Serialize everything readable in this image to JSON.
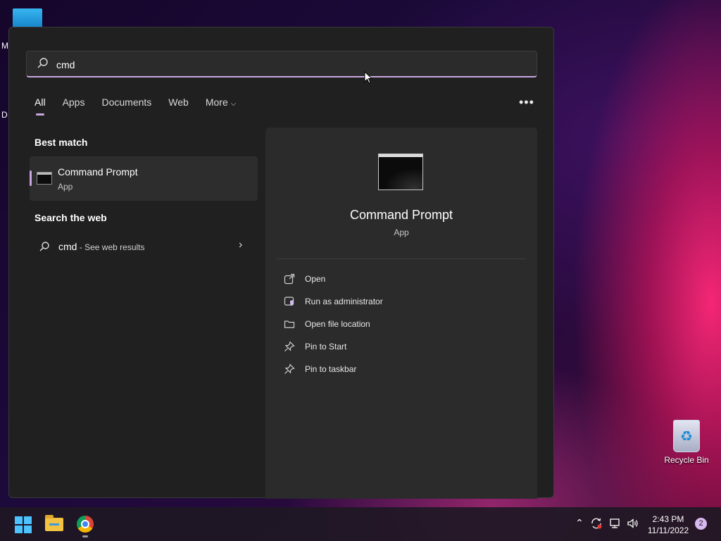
{
  "desktop": {
    "partial_labels": [
      "M",
      "D"
    ],
    "recycle_bin_label": "Recycle Bin"
  },
  "search": {
    "query": "cmd",
    "tabs": [
      {
        "label": "All",
        "active": true
      },
      {
        "label": "Apps",
        "active": false
      },
      {
        "label": "Documents",
        "active": false
      },
      {
        "label": "Web",
        "active": false
      },
      {
        "label": "More",
        "active": false
      }
    ],
    "more_options": "•••"
  },
  "best_match": {
    "section_title": "Best match",
    "title": "Command Prompt",
    "subtitle": "App"
  },
  "web_search": {
    "section_title": "Search the web",
    "query": "cmd",
    "suffix": " - See web results"
  },
  "detail": {
    "title": "Command Prompt",
    "subtitle": "App",
    "actions": [
      {
        "label": "Open",
        "icon": "open-icon"
      },
      {
        "label": "Run as administrator",
        "icon": "shield-admin-icon"
      },
      {
        "label": "Open file location",
        "icon": "folder-icon"
      },
      {
        "label": "Pin to Start",
        "icon": "pin-icon"
      },
      {
        "label": "Pin to taskbar",
        "icon": "pin-icon"
      }
    ]
  },
  "taskbar": {
    "time": "2:43 PM",
    "date": "11/11/2022",
    "notification_count": "2"
  },
  "colors": {
    "accent": "#c9a7e0",
    "panel_bg": "#202020",
    "detail_bg": "#2b2b2b",
    "win_blue": "#4cc2ff"
  }
}
